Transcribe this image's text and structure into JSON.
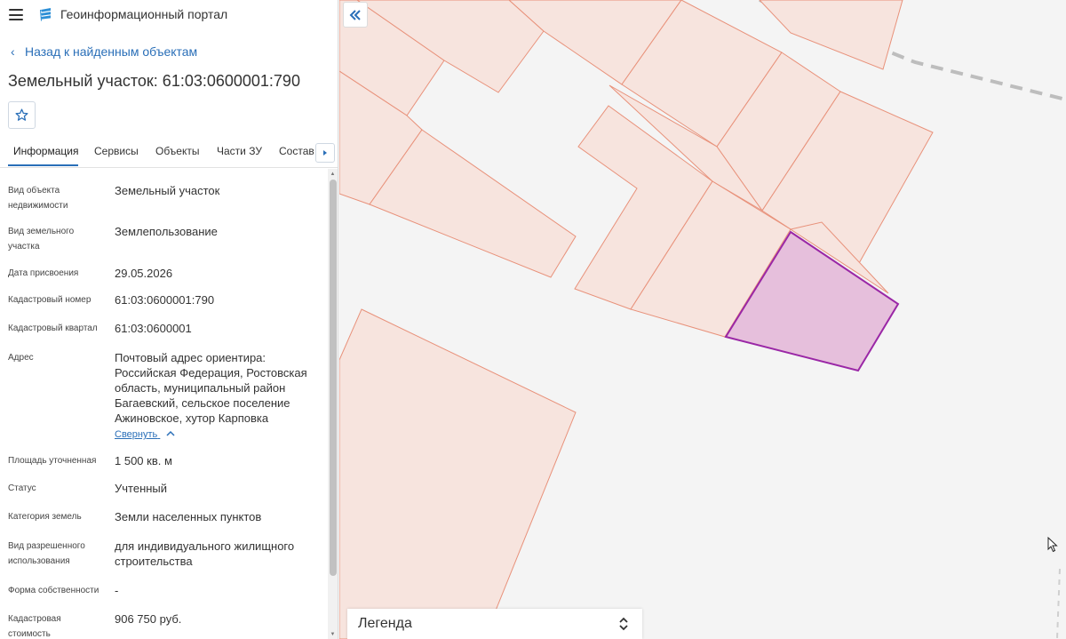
{
  "header": {
    "menu_icon": "hamburger-icon",
    "logo_icon": "portal-logo-icon",
    "title": "Геоинформационный портал"
  },
  "nav": {
    "back_label": "Назад к найденным объектам"
  },
  "object": {
    "title": "Земельный участок: 61:03:0600001:790"
  },
  "favorite_icon": "star-outline-icon",
  "tabs": [
    {
      "label": "Информация",
      "active": true
    },
    {
      "label": "Сервисы",
      "active": false
    },
    {
      "label": "Объекты",
      "active": false
    },
    {
      "label": "Части ЗУ",
      "active": false
    },
    {
      "label": "Состав",
      "active": false
    }
  ],
  "details": [
    {
      "label": "Вид объекта недвижимости",
      "value": "Земельный участок"
    },
    {
      "label": "Вид земельного участка",
      "value": "Землепользование"
    },
    {
      "label": "Дата присвоения",
      "value": "29.05.2026"
    },
    {
      "label": "Кадастровый номер",
      "value": "61:03:0600001:790"
    },
    {
      "label": "Кадастровый квартал",
      "value": "61:03:0600001"
    },
    {
      "label": "Адрес",
      "value": "Почтовый адрес ориентира: Российская Федерация, Ростовская область, муниципальный район Багаевский, сельское поселение Ажиновское, хутор Карповка"
    },
    {
      "label": "Площадь уточненная",
      "value": "1 500 кв. м"
    },
    {
      "label": "Статус",
      "value": "Учтенный"
    },
    {
      "label": "Категория земель",
      "value": "Земли населенных пунктов"
    },
    {
      "label": "Вид разрешенного использования",
      "value": "для индивидуального жилищного строительства"
    },
    {
      "label": "Форма собственности",
      "value": "-"
    },
    {
      "label": "Кадастровая стоимость",
      "value": "906 750 руб."
    }
  ],
  "address_collapse_label": "Свернуть",
  "map": {
    "parcel_fill": "#f7e4de",
    "parcel_stroke": "#e8917a",
    "selected_fill": "#e6bfdc",
    "selected_stroke": "#9a27a6",
    "background": "#f4f4f4",
    "collapse_panel_icon": "double-chevron-left-icon"
  },
  "legend": {
    "label": "Легенда",
    "icon": "chevron-up-down-icon"
  }
}
